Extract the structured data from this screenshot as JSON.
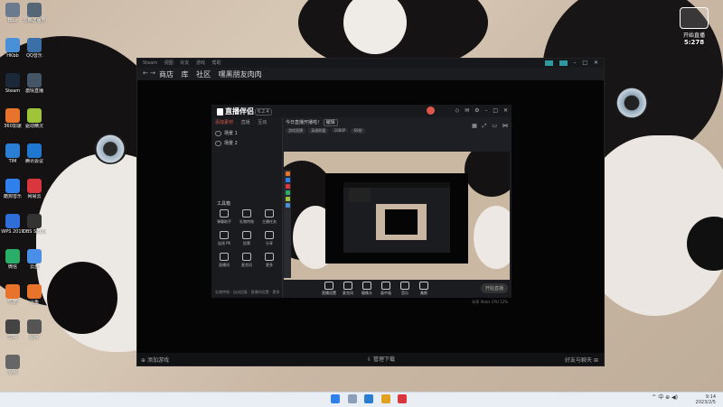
{
  "desktop": {
    "icons": [
      {
        "label": "Bbiz",
        "color": "#6b7a8c"
      },
      {
        "label": "云推送服务",
        "color": "#556677"
      },
      {
        "label": "HKbb",
        "color": "#4a90d9"
      },
      {
        "label": "QQ音乐",
        "color": "#3b6fa8"
      },
      {
        "label": "Steam",
        "color": "#1b2838"
      },
      {
        "label": "激情直播",
        "color": "#445566"
      },
      {
        "label": "360加速",
        "color": "#e8742b"
      },
      {
        "label": "驱动精灵",
        "color": "#9fc43a"
      },
      {
        "label": "TIM",
        "color": "#2a7fd4"
      },
      {
        "label": "腾讯会议",
        "color": "#1f77d0"
      },
      {
        "label": "酷狗音乐",
        "color": "#2f80ed"
      },
      {
        "label": "网易云",
        "color": "#d9363e"
      },
      {
        "label": "WPS 2019",
        "color": "#2f6ed8"
      },
      {
        "label": "OBS Studio",
        "color": "#333333"
      },
      {
        "label": "微信",
        "color": "#2aae67"
      },
      {
        "label": "云盘",
        "color": "#4a8fe7"
      },
      {
        "label": "优酷",
        "color": "#e8742b"
      },
      {
        "label": "斗鱼",
        "color": "#e8742b"
      },
      {
        "label": "剪映",
        "color": "#444444"
      },
      {
        "label": "图片",
        "color": "#555555"
      },
      {
        "label": "视频",
        "color": "#666666"
      }
    ],
    "widget": {
      "line1": "开始直播",
      "line2": "5:278"
    }
  },
  "app": {
    "titlebar_menu": [
      "Steam",
      "视图",
      "好友",
      "游戏",
      "帮助"
    ],
    "nav_links": [
      "商店",
      "库",
      "社区",
      "嘿黑朋友肉肉"
    ],
    "footer_left": "添加游戏",
    "footer_mid": "管理下载",
    "footer_right": "好友与聊天"
  },
  "inner_app": {
    "logo": "直播伴侣",
    "version": "6.2.4",
    "tabs": [
      "添加素材",
      "直播",
      "互动"
    ],
    "scenes": [
      "场景 1",
      "场景 2"
    ],
    "tools_title": "工具箱",
    "tools": [
      "弹幕助手",
      "礼物特效",
      "主播任务",
      "连线 PK",
      "投票",
      "分享",
      "直播间",
      "麦克风",
      "更多"
    ],
    "left_footer": "礼物特效 · 自动回复 · 直播间设置 · 更多",
    "info_title": "今日直播开播啦！",
    "info_badge": "编辑",
    "tags": [
      "游戏直播",
      "英雄联盟",
      "1080P",
      "60帧"
    ],
    "bottom_buttons": [
      "直播设置",
      "麦克风",
      "摄像头",
      "画中画",
      "音乐",
      "美颜"
    ],
    "go_live": "开始直播",
    "status": "码率 0kb/s  CPU 12%"
  },
  "taskbar": {
    "time": "9:14",
    "date": "2023/2/5",
    "tray_symbols": "^  中  ⊕  ◀)"
  }
}
